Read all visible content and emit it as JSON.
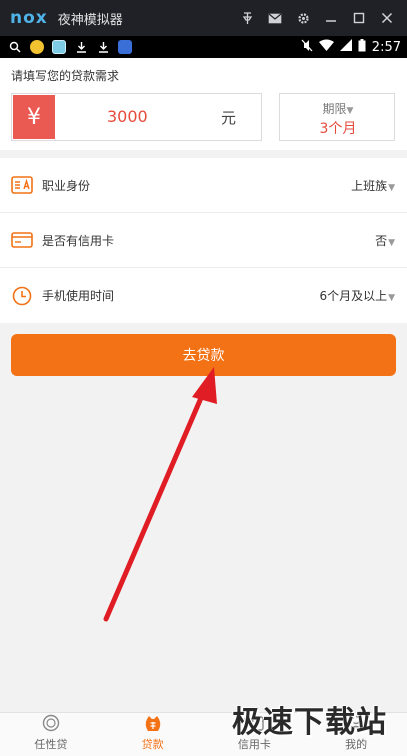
{
  "emulator": {
    "logo": "nox",
    "title": "夜神模拟器",
    "controls": [
      "pin-icon",
      "mail-icon",
      "gear-icon",
      "minimize-icon",
      "maximize-icon",
      "close-icon"
    ]
  },
  "statusbar": {
    "left_icons": [
      "search-icon",
      "android-icon",
      "app-icon",
      "download-icon",
      "download-icon",
      "baidu-icon"
    ],
    "time": "2:57"
  },
  "loan": {
    "hint": "请填写您的贷款需求",
    "currency_symbol": "¥",
    "amount": "3000",
    "unit": "元",
    "term_label": "期限",
    "term_value": "3个月"
  },
  "settings": [
    {
      "icon": "id-card-icon",
      "label": "职业身份",
      "value": "上班族"
    },
    {
      "icon": "credit-card-icon",
      "label": "是否有信用卡",
      "value": "否"
    },
    {
      "icon": "clock-icon",
      "label": "手机使用时间",
      "value": "6个月及以上"
    }
  ],
  "cta_label": "去贷款",
  "tabs": [
    {
      "icon": "coin-icon",
      "label": "任性贷",
      "active": false
    },
    {
      "icon": "loan-bag-icon",
      "label": "贷款",
      "active": true
    },
    {
      "icon": "card-icon",
      "label": "信用卡",
      "active": false
    },
    {
      "icon": "user-icon",
      "label": "我的",
      "active": false
    }
  ],
  "watermark": "极速下载站",
  "colors": {
    "accent": "#f37216",
    "amount_red": "#e64b3c",
    "yen_bg": "#ea5a52",
    "arrow": "#e01d24",
    "titlebar": "#1f2127"
  }
}
